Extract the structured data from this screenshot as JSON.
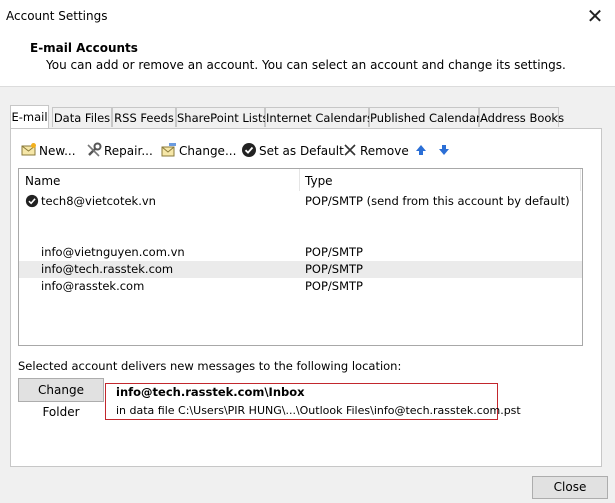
{
  "window": {
    "title": "Account Settings",
    "close_glyph": "✕"
  },
  "header": {
    "title": "E-mail Accounts",
    "description": "You can add or remove an account. You can select an account and change its settings."
  },
  "tabs": [
    {
      "label": "E-mail",
      "active": true
    },
    {
      "label": "Data Files"
    },
    {
      "label": "RSS Feeds"
    },
    {
      "label": "SharePoint Lists"
    },
    {
      "label": "Internet Calendars"
    },
    {
      "label": "Published Calendars"
    },
    {
      "label": "Address Books"
    }
  ],
  "toolbar": {
    "new_label": "New...",
    "repair_label": "Repair...",
    "change_label": "Change...",
    "set_default_label": "Set as Default",
    "remove_label": "Remove",
    "accent_color": "#2b6fd6"
  },
  "accounts": {
    "columns": {
      "name": "Name",
      "type": "Type"
    },
    "rows": [
      {
        "name": "tech8@vietcotek.vn",
        "type": "POP/SMTP (send from this account by default)",
        "default": true
      },
      {
        "name": "info@vietnguyen.com.vn",
        "type": "POP/SMTP"
      },
      {
        "name": "info@tech.rasstek.com",
        "type": "POP/SMTP",
        "selected": true
      },
      {
        "name": "info@rasstek.com",
        "type": "POP/SMTP"
      }
    ]
  },
  "delivery": {
    "description": "Selected account delivers new messages to the following location:",
    "change_folder_label": "Change Folder",
    "inbox_path": "info@tech.rasstek.com\\Inbox",
    "data_file": "in data file C:\\Users\\PIR HUNG\\...\\Outlook Files\\info@tech.rasstek.com.pst",
    "highlight_color": "#c2272d"
  },
  "footer": {
    "close_label": "Close"
  }
}
